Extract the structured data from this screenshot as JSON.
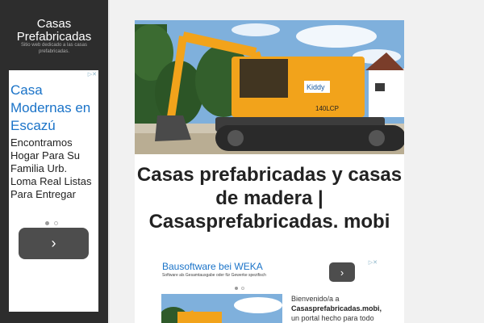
{
  "site": {
    "title": "Casas Prefabricadas",
    "description": "Sitio web dedicado a las casas prefabricadas."
  },
  "sidebar_ad": {
    "title": "Casa Modernas en Escazú",
    "body": "Encontramos Hogar Para Su Familia Urb. Loma Real Listas Para Entregar",
    "button_glyph": "›"
  },
  "post": {
    "title": "Casas prefabricadas y casas de madera | Casasprefabricadas. mobi"
  },
  "main_ad": {
    "title": "Bausoftware bei WEKA",
    "subtitle": "Software als Gesamtausgabe oder für Gewerke spezifisch",
    "button_glyph": "›"
  },
  "intro": {
    "line1": "Bienvenido/a a",
    "site_name": "Casasprefabricadas.mobi,",
    "line3": "un portal hecho para todo"
  },
  "hero_sign": "Kiddy",
  "hero_model": "140LCP",
  "icons": [
    "adchoices-icon",
    "chevron-right-icon"
  ],
  "colors": {
    "sidebar_bg": "#2d2d2d",
    "ad_link": "#1a73c8",
    "excavator": "#f2a31b"
  }
}
